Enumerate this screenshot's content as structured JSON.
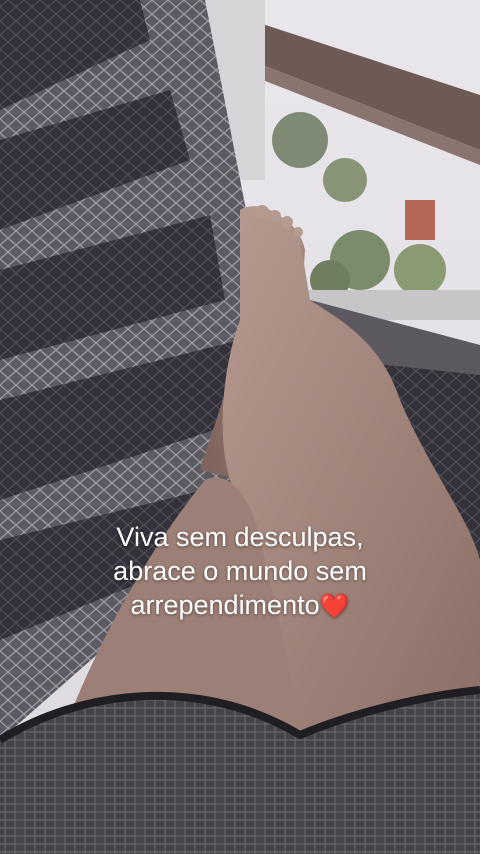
{
  "story": {
    "caption_lines": [
      "Viva sem desculpas,",
      "abrace o mundo sem",
      "arrependimento"
    ],
    "caption_emoji": "❤️",
    "caption_color": "#ffffff",
    "emoji_color": "#e0192b"
  }
}
